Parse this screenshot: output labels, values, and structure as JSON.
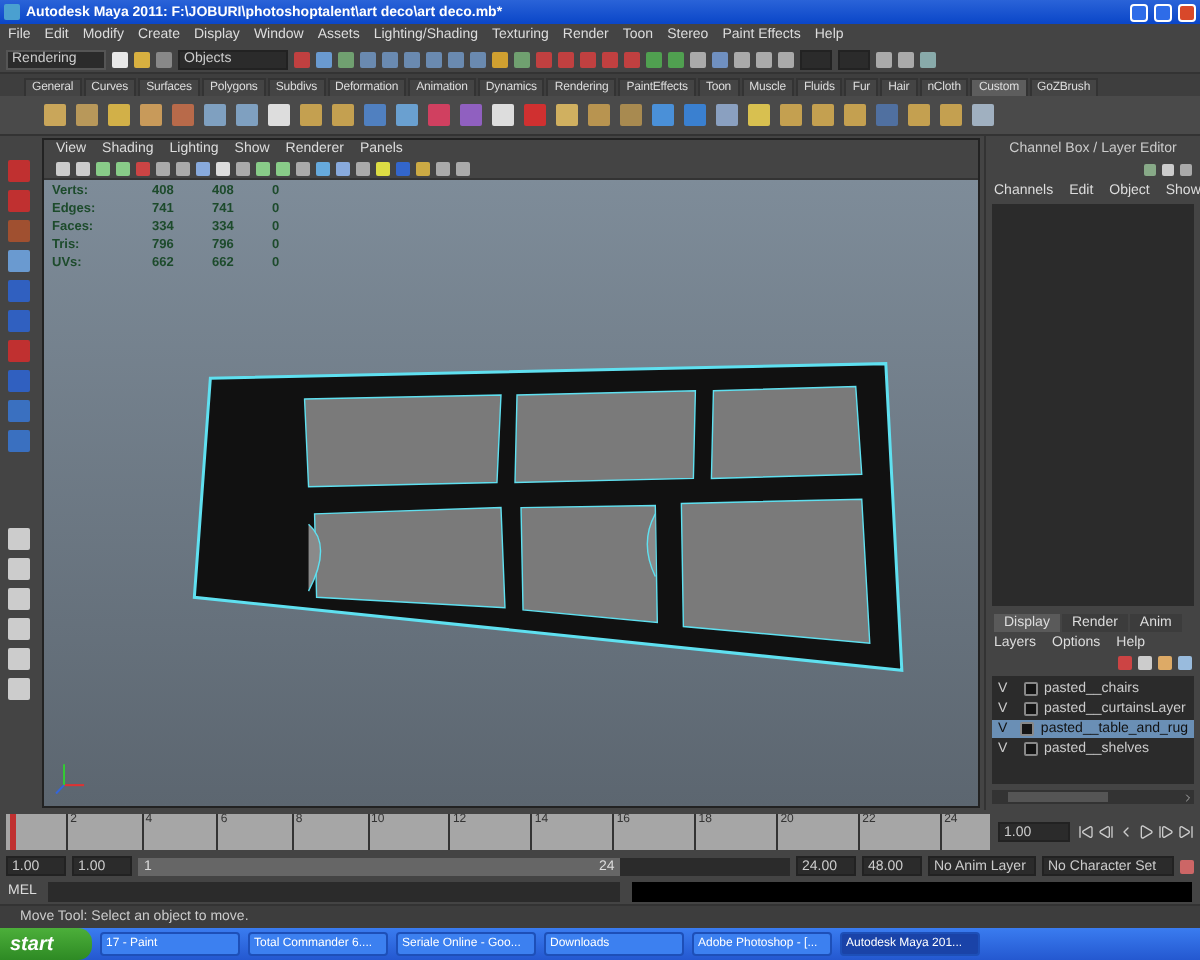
{
  "window": {
    "title": "Autodesk Maya 2011: F:\\JOBURI\\photoshoptalent\\art deco\\art deco.mb*"
  },
  "menu_bar": [
    "File",
    "Edit",
    "Modify",
    "Create",
    "Display",
    "Window",
    "Assets",
    "Lighting/Shading",
    "Texturing",
    "Render",
    "Toon",
    "Stereo",
    "Paint Effects",
    "Help"
  ],
  "status_line": {
    "menu_set": "Rendering",
    "selection_field": "Objects"
  },
  "shelf_tabs": [
    {
      "label": "General",
      "selected": false
    },
    {
      "label": "Curves",
      "selected": false
    },
    {
      "label": "Surfaces",
      "selected": false
    },
    {
      "label": "Polygons",
      "selected": false
    },
    {
      "label": "Subdivs",
      "selected": false
    },
    {
      "label": "Deformation",
      "selected": false
    },
    {
      "label": "Animation",
      "selected": false
    },
    {
      "label": "Dynamics",
      "selected": false
    },
    {
      "label": "Rendering",
      "selected": false
    },
    {
      "label": "PaintEffects",
      "selected": false
    },
    {
      "label": "Toon",
      "selected": false
    },
    {
      "label": "Muscle",
      "selected": false
    },
    {
      "label": "Fluids",
      "selected": false
    },
    {
      "label": "Fur",
      "selected": false
    },
    {
      "label": "Hair",
      "selected": false
    },
    {
      "label": "nCloth",
      "selected": false
    },
    {
      "label": "Custom",
      "selected": true
    },
    {
      "label": "GoZBrush",
      "selected": false
    }
  ],
  "viewport": {
    "menus": [
      "View",
      "Shading",
      "Lighting",
      "Show",
      "Renderer",
      "Panels"
    ],
    "stats": [
      {
        "label": "Verts:",
        "values": [
          "408",
          "408",
          "0"
        ]
      },
      {
        "label": "Edges:",
        "values": [
          "741",
          "741",
          "0"
        ]
      },
      {
        "label": "Faces:",
        "values": [
          "334",
          "334",
          "0"
        ]
      },
      {
        "label": "Tris:",
        "values": [
          "796",
          "796",
          "0"
        ]
      },
      {
        "label": "UVs:",
        "values": [
          "662",
          "662",
          "0"
        ]
      }
    ]
  },
  "channel_box": {
    "title": "Channel Box / Layer Editor",
    "menus": [
      "Channels",
      "Edit",
      "Object",
      "Show"
    ],
    "layer_tabs": [
      {
        "label": "Display",
        "selected": true
      },
      {
        "label": "Render",
        "selected": false
      },
      {
        "label": "Anim",
        "selected": false
      }
    ],
    "layer_menus": [
      "Layers",
      "Options",
      "Help"
    ],
    "layers": [
      {
        "visibility": "V",
        "name": "pasted__chairs",
        "selected": false
      },
      {
        "visibility": "V",
        "name": "pasted__curtainsLayer",
        "selected": false
      },
      {
        "visibility": "V",
        "name": "pasted__table_and_rug",
        "selected": true
      },
      {
        "visibility": "V",
        "name": "pasted__shelves",
        "selected": false
      }
    ]
  },
  "time_slider": {
    "ticks": [
      "2",
      "4",
      "6",
      "8",
      "10",
      "12",
      "14",
      "16",
      "18",
      "20",
      "22",
      "24"
    ],
    "current_time": "1.00",
    "level": 0
  },
  "range_slider": {
    "start": "1.00",
    "range_start": "1.00",
    "level": 0.74,
    "slider_start": "1",
    "slider_end": "24",
    "range_end": "24.00",
    "end": "48.00",
    "anim_layer": "No Anim Layer",
    "character_set": "No Character Set"
  },
  "command_line": {
    "label": "MEL"
  },
  "help_line": "Move Tool: Select an object to move.",
  "taskbar": {
    "start": "start",
    "items": [
      {
        "label": "17 - Paint",
        "selected": false
      },
      {
        "label": "Total Commander 6....",
        "selected": false
      },
      {
        "label": "Seriale Online - Goo...",
        "selected": false
      },
      {
        "label": "Downloads",
        "selected": false
      },
      {
        "label": "Adobe Photoshop - [...",
        "selected": false
      },
      {
        "label": "Autodesk Maya 201...",
        "selected": true
      }
    ]
  }
}
